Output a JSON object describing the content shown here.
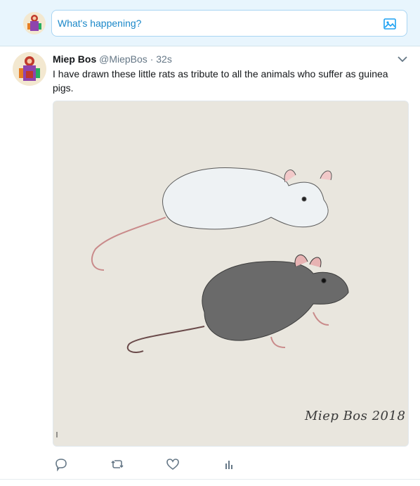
{
  "composer": {
    "placeholder": "What's happening?",
    "avatar_icon": "user-avatar-icon",
    "media_icon": "image-icon"
  },
  "tweet": {
    "name": "Miep Bos",
    "handle": "@MiepBos",
    "separator": "·",
    "time": "32s",
    "text": "I have drawn these little rats as tribute to all the animals who suffer as guinea pigs.",
    "media": {
      "signature": "Miep Bos 2018",
      "description_icon": "drawing-image"
    },
    "actions": {
      "reply_icon": "reply-icon",
      "retweet_icon": "retweet-icon",
      "like_icon": "heart-icon",
      "analytics_icon": "analytics-icon"
    }
  },
  "colors": {
    "accent": "#1da1f2",
    "composer_bg": "#e8f5fd",
    "muted": "#657786"
  }
}
